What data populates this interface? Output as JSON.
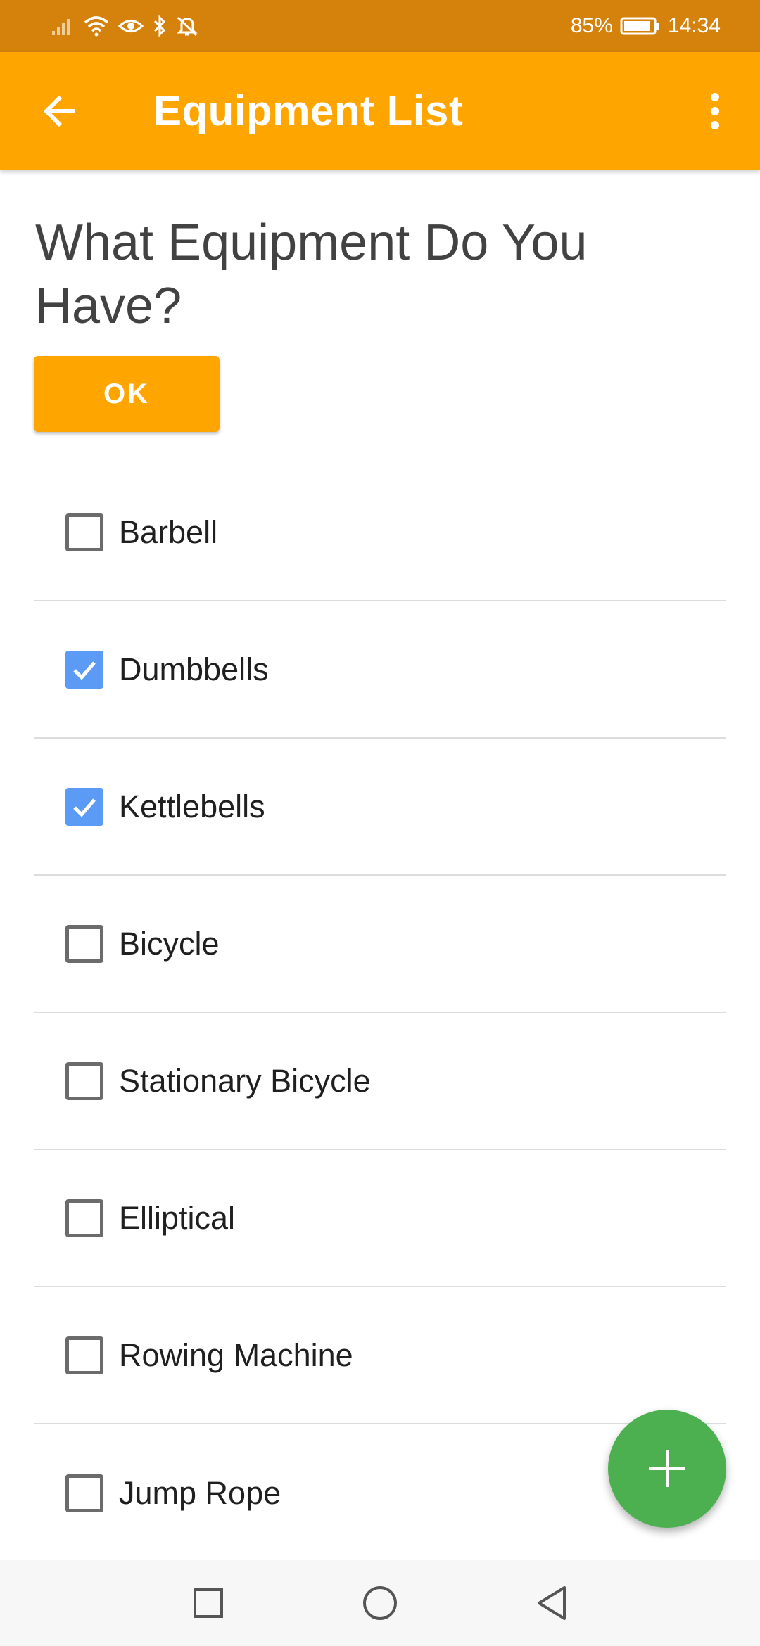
{
  "status_bar": {
    "battery": "85%",
    "time": "14:34",
    "icons": [
      "signal-icon",
      "wifi-icon",
      "eye-icon",
      "bluetooth-icon",
      "bell-off-icon",
      "battery-icon"
    ]
  },
  "app_bar": {
    "title": "Equipment List",
    "back_icon": "arrow-left-icon",
    "menu_icon": "more-vert-icon",
    "color": "#FFA500"
  },
  "main": {
    "heading": "What Equipment Do You Have?",
    "ok_label": "OK"
  },
  "equipment": [
    {
      "label": "Barbell",
      "checked": false
    },
    {
      "label": "Dumbbells",
      "checked": true
    },
    {
      "label": "Kettlebells",
      "checked": true
    },
    {
      "label": "Bicycle",
      "checked": false
    },
    {
      "label": "Stationary Bicycle",
      "checked": false
    },
    {
      "label": "Elliptical",
      "checked": false
    },
    {
      "label": "Rowing Machine",
      "checked": false
    },
    {
      "label": "Jump Rope",
      "checked": false
    }
  ],
  "fab": {
    "icon": "plus-icon",
    "color": "#4CAF50"
  },
  "nav_bar": {
    "icons": [
      "recents-square-icon",
      "home-circle-icon",
      "back-triangle-icon"
    ]
  },
  "colors": {
    "status_bar": "#D4820B",
    "accent": "#FFA500",
    "checkbox_checked": "#5B9BF5"
  }
}
